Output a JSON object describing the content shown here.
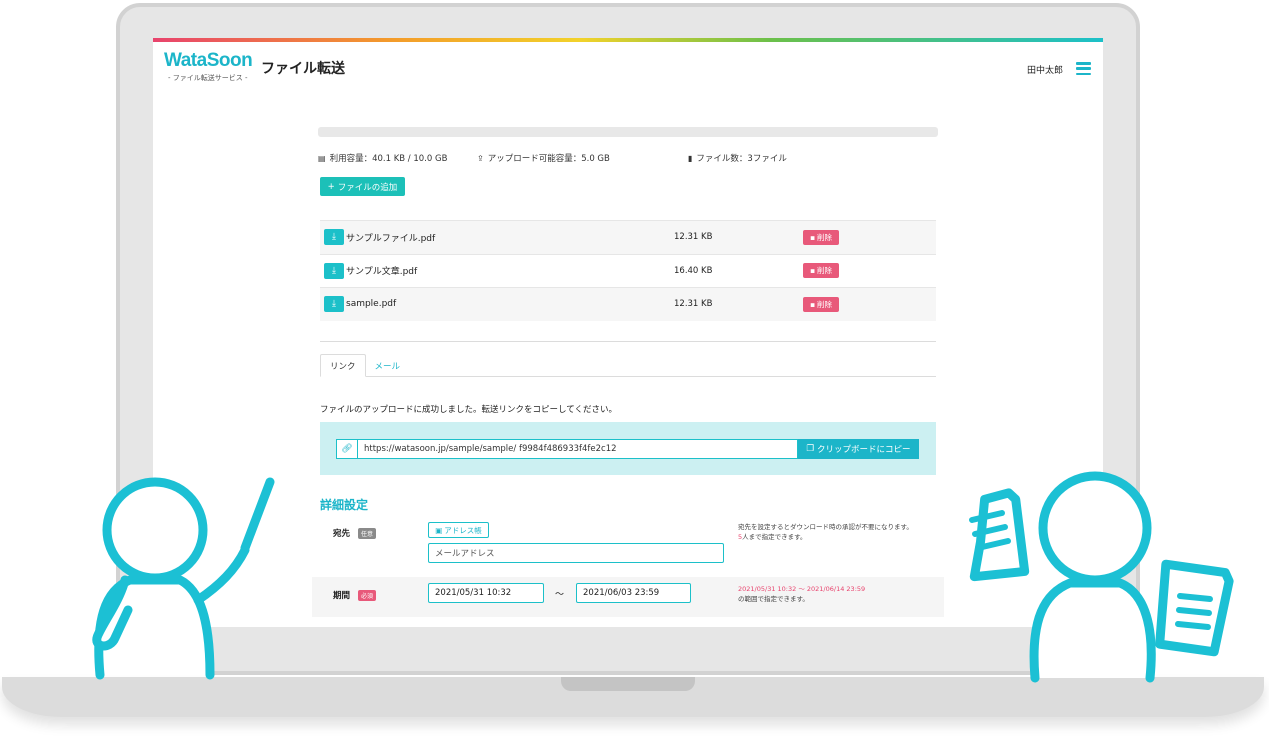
{
  "header": {
    "logo_text": "WataSoon",
    "logo_sub": "- ファイル転送サービス -",
    "title": "ファイル転送",
    "user_name": "田中太郎"
  },
  "stats": {
    "capacity_used_fraction": 0.0,
    "used": "利用容量：40.1 KB / 10.0 GB",
    "upload_capacity": "アップロード可能容量：5.0 GB",
    "file_count": "ファイル数：3ファイル"
  },
  "add_file_label": "ファイルの追加",
  "files": [
    {
      "name": "サンプルファイル.pdf",
      "size": "12.31 KB",
      "delete_label": "削除"
    },
    {
      "name": "サンプル文章.pdf",
      "size": "16.40 KB",
      "delete_label": "削除"
    },
    {
      "name": "sample.pdf",
      "size": "12.31 KB",
      "delete_label": "削除"
    }
  ],
  "tabs": [
    {
      "label": "リンク",
      "active": true
    },
    {
      "label": "メール",
      "active": false
    }
  ],
  "success_message": "ファイルのアップロードに成功しました。転送リンクをコピーしてください。",
  "link": {
    "url": "https://watasoon.jp/sample/sample/ f9984f486933f4fe2c12",
    "copy_label": "クリップボードにコピー"
  },
  "details": {
    "section_title": "詳細設定",
    "recipient_label": "宛先",
    "optional_badge": "任意",
    "address_book_label": "アドレス帳",
    "email_placeholder": "メールアドレス",
    "recipient_hint_1": "宛先を設定するとダウンロード時の承認が不要になります。",
    "recipient_hint_count": "5",
    "recipient_hint_2": "人まで指定できます。",
    "period_label": "期間",
    "required_badge": "必須",
    "start_date": "2021/05/31 10:32",
    "tilde": "〜",
    "end_date": "2021/06/03 23:59",
    "period_hint_range": "2021/05/31 10:32 〜 2021/06/14 23:59",
    "period_hint_2": "の範囲で指定できます。"
  },
  "colors": {
    "accent": "#1cb5c9",
    "danger": "#e8597a",
    "panel": "#ccf0f2"
  }
}
